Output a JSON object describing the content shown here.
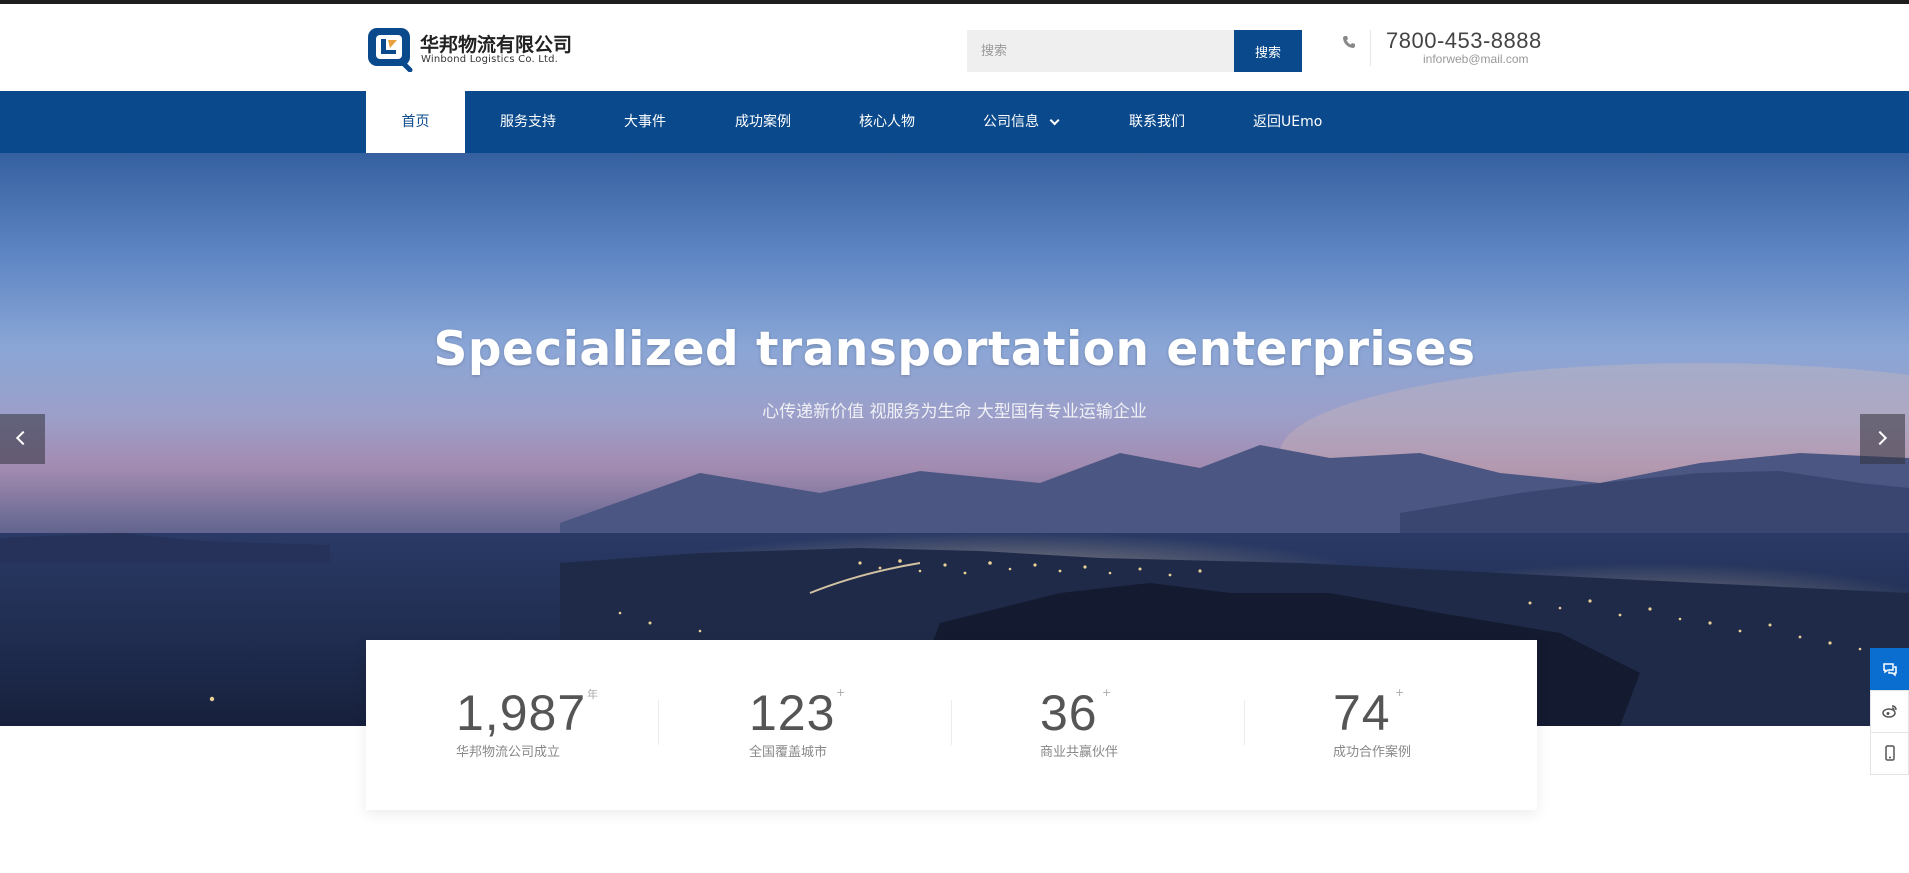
{
  "brand": {
    "name_cn": "华邦物流有限公司",
    "name_en": "Winbond Logistics Co. Ltd.",
    "colors": {
      "primary": "#0a4a8c",
      "accent": "#e8a13a",
      "side_active": "#0a6ed1"
    }
  },
  "search": {
    "placeholder": "搜索",
    "button_label": "搜索"
  },
  "contact": {
    "icon": "phone-icon",
    "phone": "7800-453-8888",
    "email": "inforweb@mail.com"
  },
  "nav": {
    "items": [
      {
        "label": "首页",
        "active": true
      },
      {
        "label": "服务支持"
      },
      {
        "label": "大事件"
      },
      {
        "label": "成功案例"
      },
      {
        "label": "核心人物"
      },
      {
        "label": "公司信息",
        "has_dropdown": true
      },
      {
        "label": "联系我们"
      },
      {
        "label": "返回UEmo"
      }
    ]
  },
  "hero": {
    "title": "Specialized transportation enterprises",
    "subtitle": "心传递新价值 视服务为生命 大型国有专业运输企业",
    "prev_icon": "chevron-left-icon",
    "next_icon": "chevron-right-icon"
  },
  "stats": [
    {
      "value": "1,987",
      "unit": "年",
      "label": "华邦物流公司成立"
    },
    {
      "value": "123",
      "unit": "+",
      "label": "全国覆盖城市"
    },
    {
      "value": "36",
      "unit": "+",
      "label": "商业共赢伙伴"
    },
    {
      "value": "74",
      "unit": "+",
      "label": "成功合作案例"
    }
  ],
  "side_float": [
    {
      "icon": "chat-icon"
    },
    {
      "icon": "weibo-icon"
    },
    {
      "icon": "mobile-icon"
    }
  ]
}
